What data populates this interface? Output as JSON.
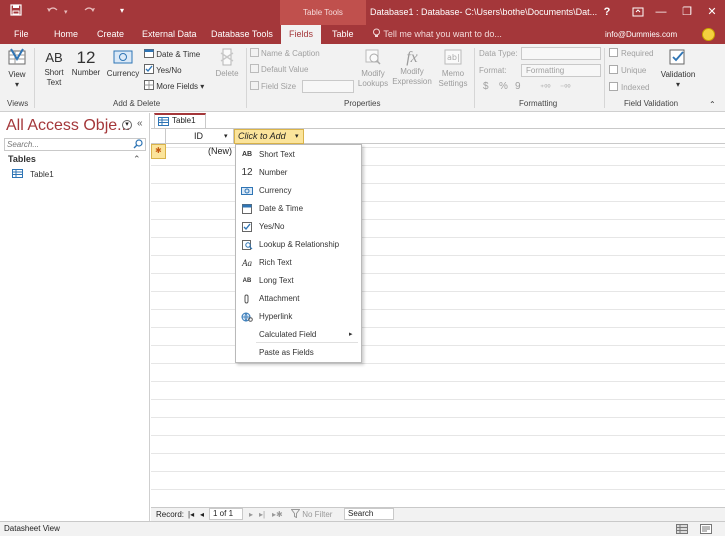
{
  "title_bar": {
    "save_icon": "save-icon",
    "undo_icon": "undo-icon",
    "redo_icon": "redo-icon",
    "context_label": "Table Tools",
    "document_title": "Database1 : Database- C:\\Users\\bothe\\Documents\\Dat...",
    "help": "?",
    "minimize": "—",
    "restore": "❐",
    "close": "✕"
  },
  "tabs": [
    {
      "label": "File"
    },
    {
      "label": "Home"
    },
    {
      "label": "Create"
    },
    {
      "label": "External Data"
    },
    {
      "label": "Database Tools"
    },
    {
      "label": "Fields"
    },
    {
      "label": "Table"
    }
  ],
  "tell_me": "Tell me what you want to do...",
  "account": "info@Dummies.com",
  "ribbon": {
    "views": {
      "view_label": "View",
      "group": "Views"
    },
    "add_delete": {
      "short_text": "Short Text",
      "number": "Number",
      "currency": "Currency",
      "date_time": "Date & Time",
      "yes_no": "Yes/No",
      "more_fields": "More Fields",
      "delete": "Delete",
      "group": "Add & Delete"
    },
    "properties": {
      "name_caption": "Name & Caption",
      "default_value": "Default Value",
      "field_size": "Field Size",
      "modify_lookups": "Modify Lookups",
      "modify_expression": "Modify Expression",
      "memo_settings": "Memo Settings",
      "group": "Properties"
    },
    "formatting": {
      "data_type_label": "Data Type:",
      "format_label": "Format:",
      "format_value": "Formatting",
      "currency_symbol": "$",
      "percent_symbol": "%",
      "comma_symbol": "9",
      "group": "Formatting"
    },
    "validation": {
      "required": "Required",
      "unique": "Unique",
      "indexed": "Indexed",
      "validation": "Validation",
      "group": "Field Validation"
    }
  },
  "nav_pane": {
    "title": "All Access Obje...",
    "search_placeholder": "Search...",
    "section": "Tables",
    "items": [
      {
        "label": "Table1"
      }
    ]
  },
  "doc_tab": "Table1",
  "datasheet": {
    "col_id": "ID",
    "col_add": "Click to Add",
    "new_row": "(New)"
  },
  "field_menu": [
    {
      "icon": "AB",
      "label": "Short Text"
    },
    {
      "icon": "12",
      "label": "Number"
    },
    {
      "icon": "currency-icon",
      "label": "Currency"
    },
    {
      "icon": "calendar-icon",
      "label": "Date & Time"
    },
    {
      "icon": "checkbox-icon",
      "label": "Yes/No"
    },
    {
      "icon": "lookup-icon",
      "label": "Lookup & Relationship"
    },
    {
      "icon": "Aa",
      "label": "Rich Text"
    },
    {
      "icon": "AB",
      "label": "Long Text"
    },
    {
      "icon": "paperclip-icon",
      "label": "Attachment"
    },
    {
      "icon": "globe-icon",
      "label": "Hyperlink"
    },
    {
      "icon": "",
      "label": "Calculated Field"
    },
    {
      "icon": "",
      "label": "Paste as Fields"
    }
  ],
  "record_nav": {
    "label": "Record:",
    "position": "1 of 1",
    "filter": "No Filter",
    "search": "Search"
  },
  "status_bar": {
    "text": "Datasheet View"
  }
}
